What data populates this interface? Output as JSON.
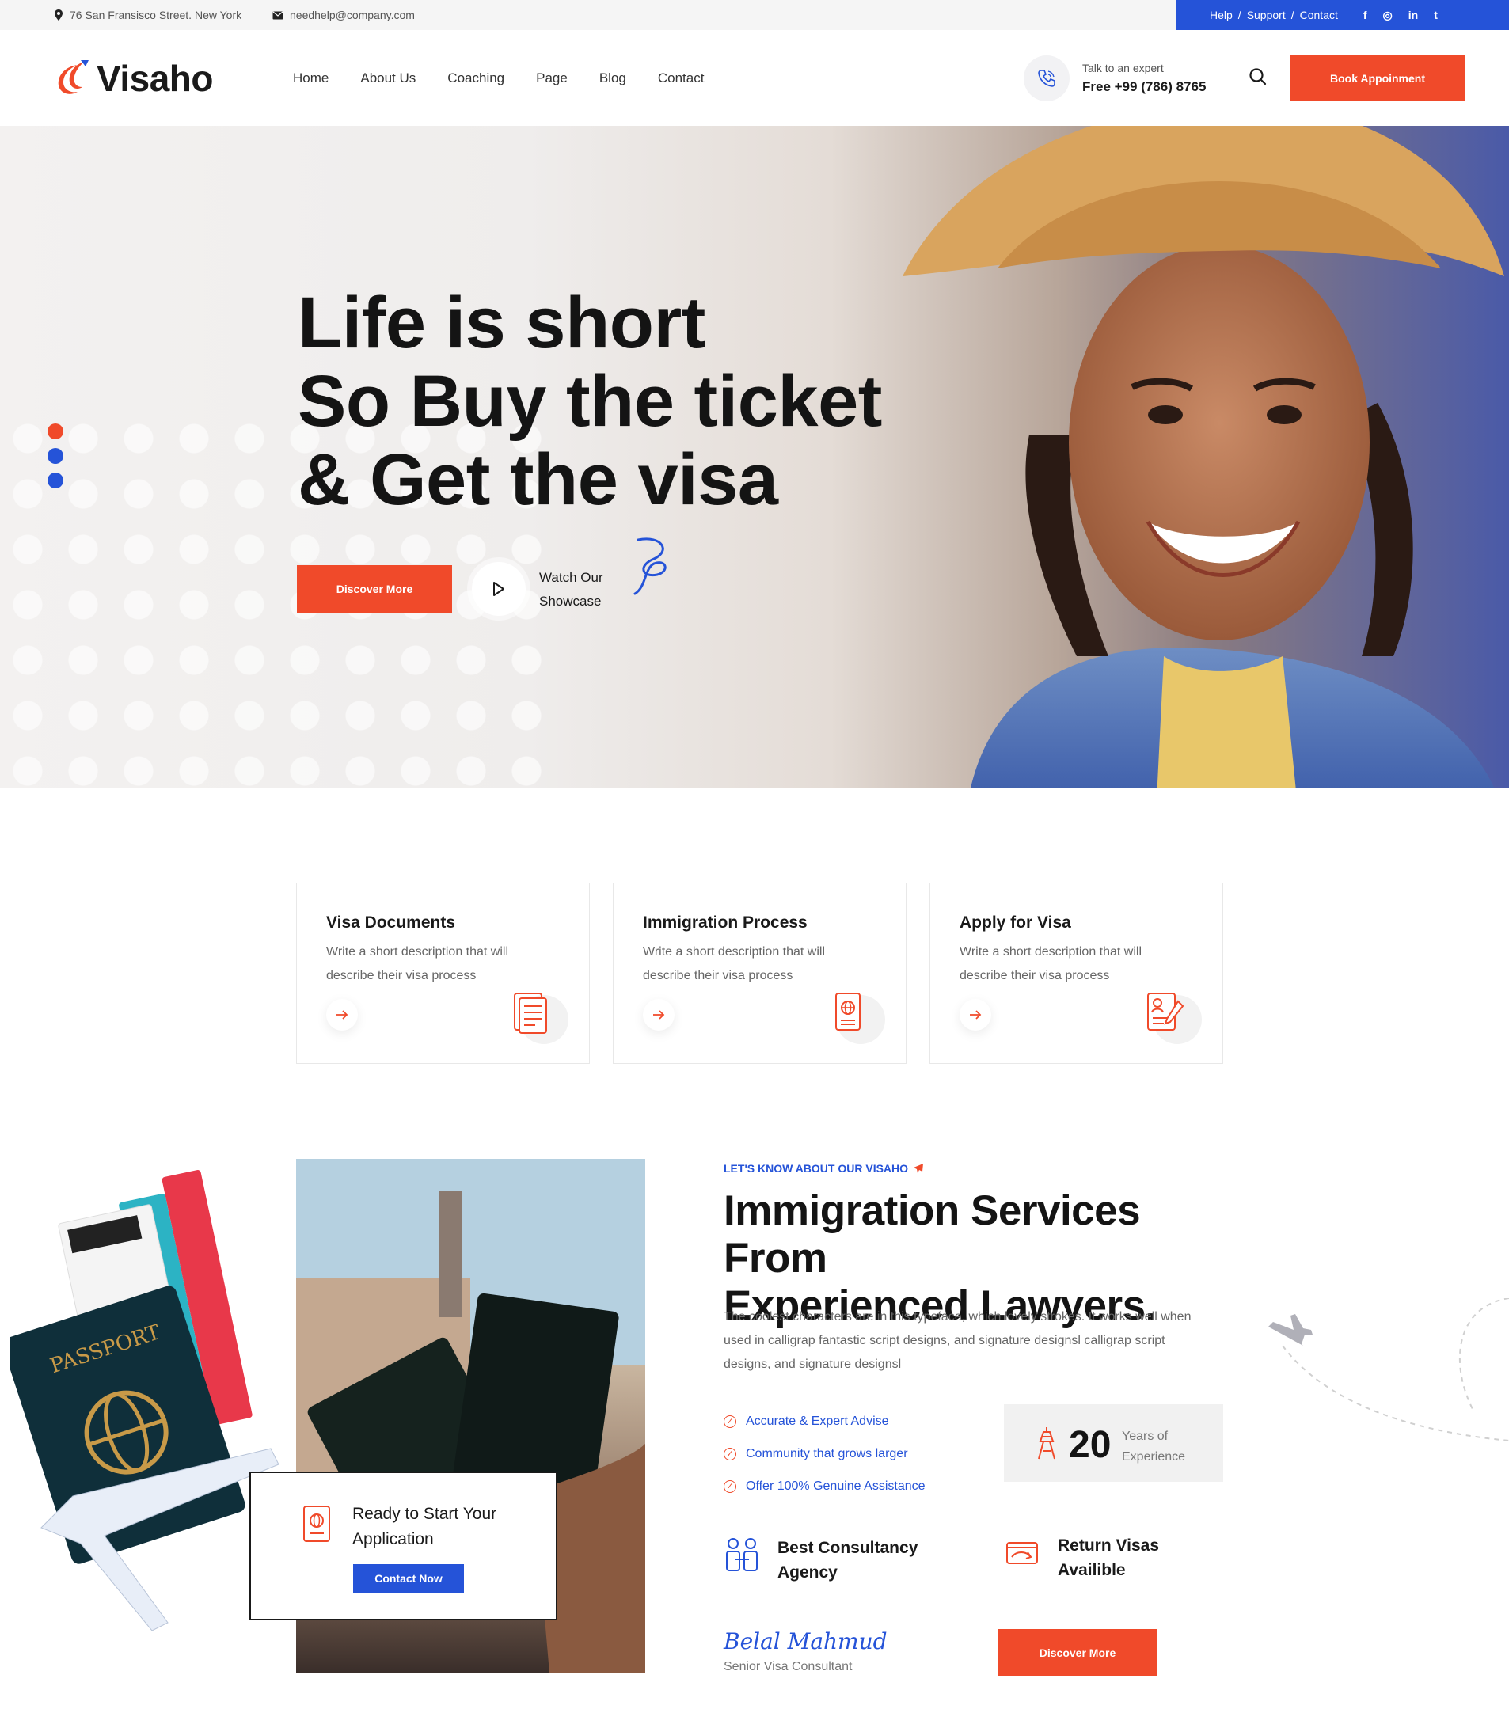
{
  "topbar": {
    "address": "76 San Fransisco Street. New York",
    "email": "needhelp@company.com",
    "links": [
      "Help",
      "Support",
      "Contact"
    ],
    "socials": [
      "f",
      "◎",
      "in",
      "t"
    ]
  },
  "header": {
    "logo": "Visaho",
    "nav": [
      "Home",
      "About Us",
      "Coaching",
      "Page",
      "Blog",
      "Contact"
    ],
    "expert_label": "Talk to an expert",
    "expert_phone": "Free +99 (786) 8765",
    "book_label": "Book Appoinment"
  },
  "hero": {
    "headline_line1": "Life is short",
    "headline_line2": "So Buy the ticket",
    "headline_line3": "& Get the visa",
    "cta_label": "Discover More",
    "watch_line1": "Watch Our",
    "watch_line2": "Showcase"
  },
  "cards": [
    {
      "title": "Visa Documents",
      "desc": "Write a short description that will describe their visa process"
    },
    {
      "title": "Immigration Process",
      "desc": "Write a short description that will describe their visa process"
    },
    {
      "title": "Apply for Visa",
      "desc": "Write a short description that will describe their visa process"
    }
  ],
  "about": {
    "kicker": "LET'S KNOW ABOUT OUR VISAHO",
    "heading_line1": "Immigration Services From",
    "heading_line2": "Experienced Lawyers.",
    "paragraph": "The coolest characters are in this typeface, which lovely strokes. It works well when used in calligrap fantastic script designs, and signature designsl calligrap script designs, and signature designsl",
    "checks": [
      "Accurate & Expert Advise",
      "Community that grows larger",
      "Offer 100% Genuine Assistance"
    ],
    "years_number": "20",
    "years_line1": "Years of",
    "years_line2": "Experience",
    "feature1_line1": "Best Consultancy",
    "feature1_line2": "Agency",
    "feature2_line1": "Return Visas",
    "feature2_line2": "Availible",
    "signature": "Belal Mahmud",
    "signature_role": "Senior Visa Consultant",
    "discover_label": "Discover More",
    "ready_line1": "Ready to Start Your",
    "ready_line2": "Application",
    "contact_label": "Contact Now"
  },
  "colors": {
    "accent_orange": "#f04a2a",
    "accent_blue": "#2553d8",
    "text_dark": "#141414"
  }
}
